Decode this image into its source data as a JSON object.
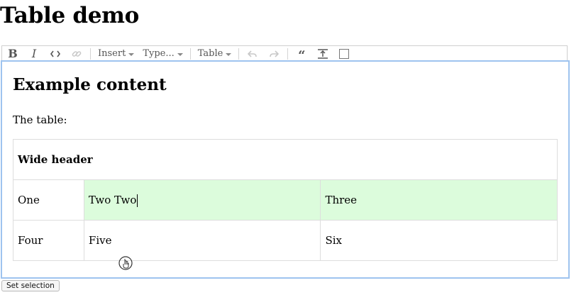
{
  "page": {
    "title": "Table demo"
  },
  "menubar": {
    "items": [
      {
        "type": "icon",
        "name": "bold",
        "label": "B"
      },
      {
        "type": "icon",
        "name": "italic",
        "label": "I"
      },
      {
        "type": "icon",
        "name": "code",
        "label": "<>"
      },
      {
        "type": "icon",
        "name": "link",
        "label": "🔗"
      }
    ],
    "insert_label": "Insert",
    "type_label": "Type...",
    "table_label": "Table"
  },
  "editor": {
    "heading": "Example content",
    "paragraph": "The table:",
    "table": {
      "header": "Wide header",
      "rows": [
        [
          "One",
          "Two Two",
          "Three"
        ],
        [
          "Four",
          "Five",
          "Six"
        ]
      ]
    }
  },
  "controls": {
    "set_selection_label": "Set selection"
  },
  "colors": {
    "selected_cell": "#dcfcdc",
    "focus_outline": "#9ec3ef"
  }
}
